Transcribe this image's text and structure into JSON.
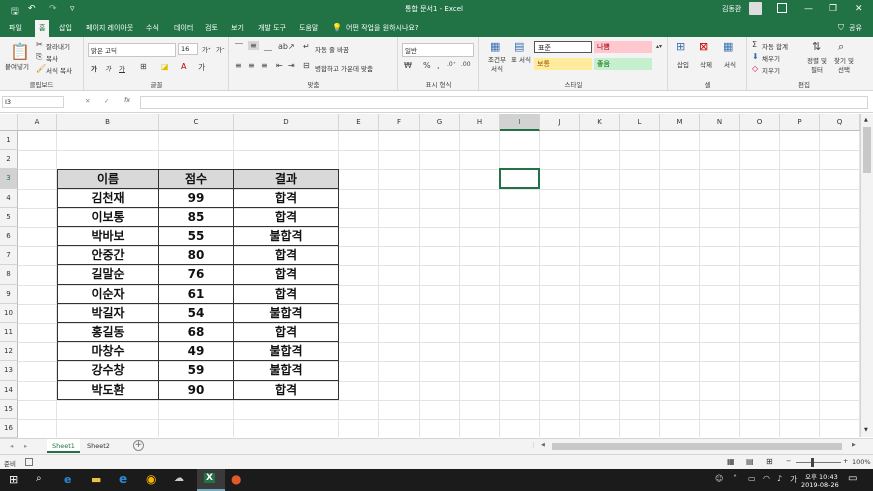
{
  "window": {
    "title": "통합 문서1  -  Excel",
    "user": "김동환",
    "share": "공유"
  },
  "tabs": [
    "파일",
    "홈",
    "삽입",
    "페이지 레이아웃",
    "수식",
    "데이터",
    "검토",
    "보기",
    "개발 도구",
    "도움말"
  ],
  "tell_me": "어떤 작업을 원하시나요?",
  "ribbon": {
    "clipboard": {
      "label": "클립보드",
      "paste": "붙여넣기",
      "cut": "잘라내기",
      "copy": "복사",
      "format_painter": "서식 복사"
    },
    "font": {
      "label": "글꼴",
      "name": "맑은 고딕",
      "size": "16",
      "bold": "가",
      "italic": "가",
      "underline": "가"
    },
    "alignment": {
      "label": "맞춤",
      "wrap": "자동 줄 바꿈",
      "merge": "병합하고 가운데 맞춤"
    },
    "number": {
      "label": "표시 형식",
      "format": "일반"
    },
    "styles": {
      "label": "스타일",
      "conditional": "조건부 서식",
      "table": "표 서식",
      "normal": "표준",
      "bad": "나쁨",
      "neutral": "보통",
      "good": "좋음"
    },
    "cells": {
      "label": "셀",
      "insert": "삽입",
      "delete": "삭제",
      "format": "서식"
    },
    "editing": {
      "label": "편집",
      "autosum": "자동 합계",
      "fill": "채우기",
      "clear": "지우기",
      "sort": "정렬 및 필터",
      "find": "찾기 및 선택"
    }
  },
  "formula_bar": {
    "name_box": "I3",
    "fx": "fx",
    "value": ""
  },
  "columns": [
    "A",
    "B",
    "C",
    "D",
    "E",
    "F",
    "G",
    "H",
    "I",
    "J",
    "K",
    "L",
    "M",
    "N",
    "O",
    "P",
    "Q"
  ],
  "rows": [
    "1",
    "2",
    "3",
    "4",
    "5",
    "6",
    "7",
    "8",
    "9",
    "10",
    "11",
    "12",
    "13",
    "14",
    "15",
    "16"
  ],
  "table": {
    "headers": [
      "이름",
      "점수",
      "결과"
    ],
    "rows": [
      [
        "김천재",
        "99",
        "합격"
      ],
      [
        "이보통",
        "85",
        "합격"
      ],
      [
        "박바보",
        "55",
        "불합격"
      ],
      [
        "안중간",
        "80",
        "합격"
      ],
      [
        "길말순",
        "76",
        "합격"
      ],
      [
        "이순자",
        "61",
        "합격"
      ],
      [
        "박길자",
        "54",
        "불합격"
      ],
      [
        "홍길동",
        "68",
        "합격"
      ],
      [
        "마창수",
        "49",
        "불합격"
      ],
      [
        "강수창",
        "59",
        "불합격"
      ],
      [
        "박도환",
        "90",
        "합격"
      ]
    ]
  },
  "sheets": {
    "tabs": [
      "Sheet1",
      "Sheet2"
    ],
    "active": "Sheet1"
  },
  "status": {
    "mode": "준비",
    "zoom": "100%"
  },
  "clock": {
    "time": "오후 10:43",
    "date": "2019-08-26"
  }
}
